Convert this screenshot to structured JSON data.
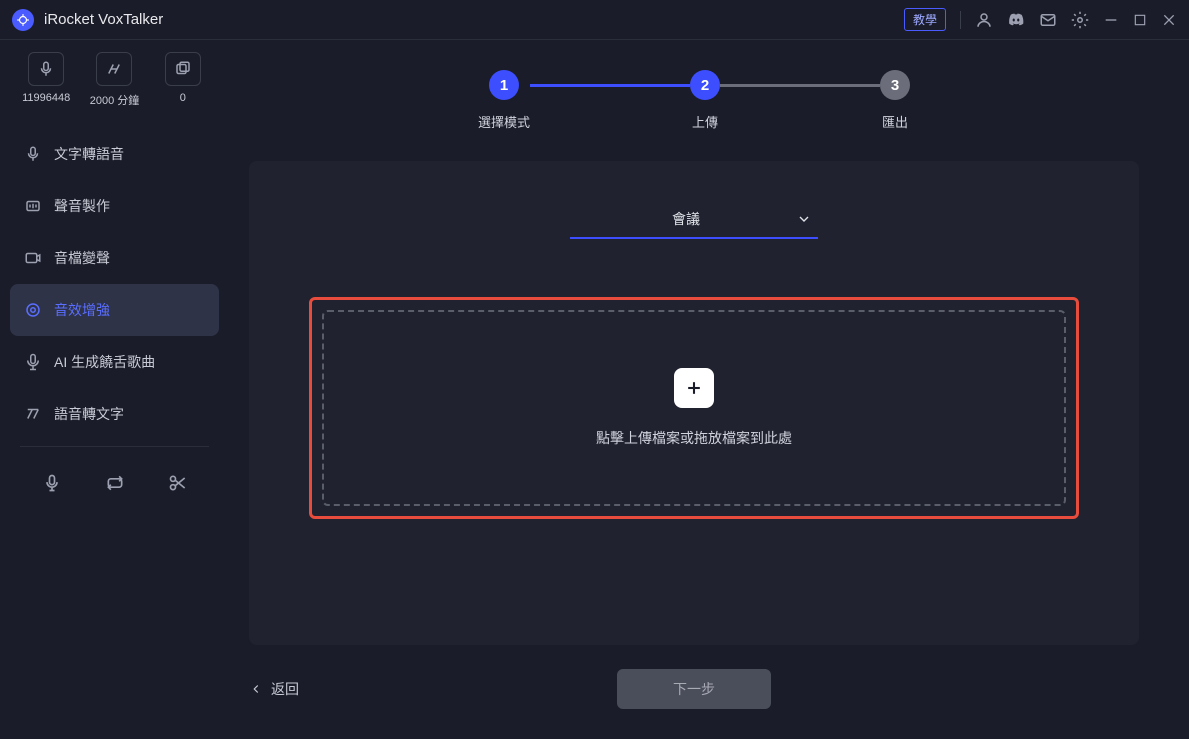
{
  "app": {
    "title": "iRocket VoxTalker"
  },
  "titlebar": {
    "tutorial": "教學"
  },
  "stats": [
    {
      "label": "11996448"
    },
    {
      "label": "2000 分鐘"
    },
    {
      "label": "0"
    }
  ],
  "nav": {
    "items": [
      {
        "label": "文字轉語音"
      },
      {
        "label": "聲音製作"
      },
      {
        "label": "音檔變聲"
      },
      {
        "label": "音效增強"
      },
      {
        "label": "AI 生成饒舌歌曲"
      },
      {
        "label": "語音轉文字"
      }
    ]
  },
  "steps": [
    {
      "num": "1",
      "label": "選擇模式"
    },
    {
      "num": "2",
      "label": "上傳"
    },
    {
      "num": "3",
      "label": "匯出"
    }
  ],
  "select": {
    "value": "會議"
  },
  "upload": {
    "text": "點擊上傳檔案或拖放檔案到此處"
  },
  "footer": {
    "back": "返回",
    "next": "下一步"
  }
}
